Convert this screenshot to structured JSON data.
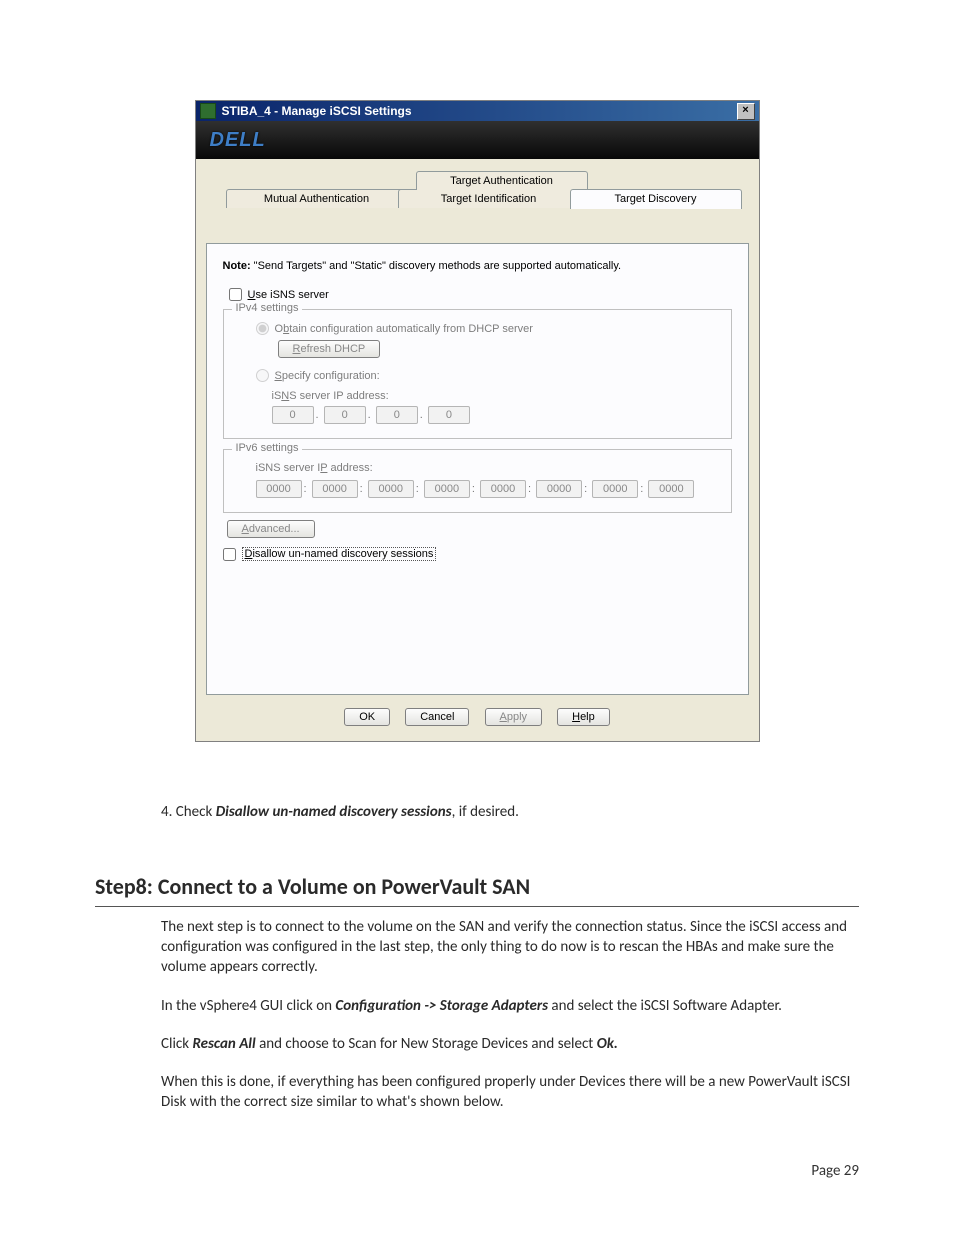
{
  "dialog": {
    "title": "STIBA_4 - Manage iSCSI Settings",
    "logo_text": "DELL",
    "tabs": {
      "target_auth": "Target Authentication",
      "mutual_auth": "Mutual Authentication",
      "target_ident": "Target Identification",
      "target_disc": "Target Discovery"
    },
    "note_label": "Note:",
    "note_text": " \"Send Targets\" and \"Static\" discovery methods are supported automatically.",
    "use_isns": "Use iSNS server",
    "ipv4_legend": "IPv4 settings",
    "radio_dhcp": "Obtain configuration automatically from DHCP server",
    "refresh_dhcp": "Refresh DHCP",
    "radio_specify": "Specify configuration:",
    "isns_ip_label": "iSNS server IP address:",
    "ipv4_octets": [
      "0",
      "0",
      "0",
      "0"
    ],
    "ipv6_legend": "IPv6 settings",
    "isns_ip6_label": "iSNS server IP address:",
    "ipv6_groups": [
      "0000",
      "0000",
      "0000",
      "0000",
      "0000",
      "0000",
      "0000",
      "0000"
    ],
    "advanced": "Advanced...",
    "disallow": "Disallow un-named discovery sessions",
    "buttons": {
      "ok": "OK",
      "cancel": "Cancel",
      "apply": "Apply",
      "help": "Help"
    }
  },
  "doc": {
    "step4_prefix": "4. Check ",
    "step4_bi": "Disallow un-named discovery sessions",
    "step4_suffix": ", if desired.",
    "heading": "Step8: Connect to a Volume on PowerVault SAN",
    "p1": "The next step is to connect to the volume on the SAN and verify the connection status. Since the iSCSI access and configuration was configured in the last step, the only thing to do now is to rescan the HBAs and make sure the volume appears correctly.",
    "p2_a": "In the vSphere4 GUI click on ",
    "p2_bi": "Configuration -> Storage Adapters",
    "p2_b": " and select the iSCSI Software Adapter.",
    "p3_a": "Click ",
    "p3_bi1": "Rescan All",
    "p3_b": " and choose to Scan for New Storage Devices and select ",
    "p3_bi2": "Ok.",
    "p4": "When this is done, if everything has been configured properly under Devices there will be a new PowerVault iSCSI Disk with the correct size similar to what's shown below.",
    "page_num": "Page 29"
  }
}
